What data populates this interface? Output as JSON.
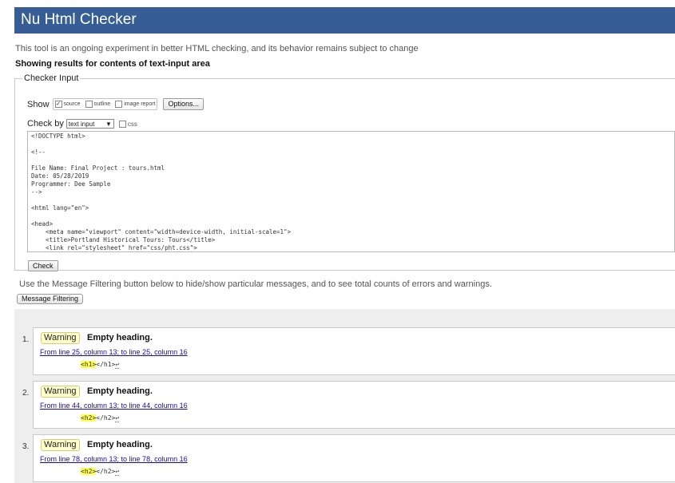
{
  "header": {
    "title": "Nu Html Checker"
  },
  "intro": "This tool is an ongoing experiment in better HTML checking, and its behavior remains subject to change",
  "showing": "Showing results for contents of text-input area",
  "checker": {
    "legend": "Checker Input",
    "show_label": "Show",
    "show_options": [
      {
        "label": "source",
        "checked": true
      },
      {
        "label": "outline",
        "checked": false
      },
      {
        "label": "image report",
        "checked": false
      }
    ],
    "options_button": "Options...",
    "check_by_label": "Check by",
    "check_by_value": "text input",
    "css_label": "css",
    "source_text": "<!DOCTYPE html>\n\n<!--\n\nFile Name: Final Project : tours.html\nDate: 05/28/2019\nProgrammer: Dee Sample\n-->\n\n<html lang=\"en\">\n\n<head>\n    <meta name=\"viewport\" content=\"width=device-width, initial-scale=1\">\n    <title>Portland Historical Tours: Tours</title>\n    <link rel=\"stylesheet\" href=\"css/pht.css\">",
    "check_button": "Check"
  },
  "filter": {
    "text": "Use the Message Filtering button below to hide/show particular messages, and to see total counts of errors and warnings.",
    "button": "Message Filtering"
  },
  "messages": [
    {
      "num": "1.",
      "type": "Warning",
      "title": "Empty heading.",
      "location": "From line 25, column 13; to line 25, column 16",
      "tag": "<h1>",
      "rest": "</h1>",
      "lf": "↩"
    },
    {
      "num": "2.",
      "type": "Warning",
      "title": "Empty heading.",
      "location": "From line 44, column 13; to line 44, column 16",
      "tag": "<h2>",
      "rest": "</h2>",
      "lf": "↩"
    },
    {
      "num": "3.",
      "type": "Warning",
      "title": "Empty heading.",
      "location": "From line 78, column 13; to line 78, column 16",
      "tag": "<h2>",
      "rest": "</h2>",
      "lf": "↩"
    }
  ]
}
